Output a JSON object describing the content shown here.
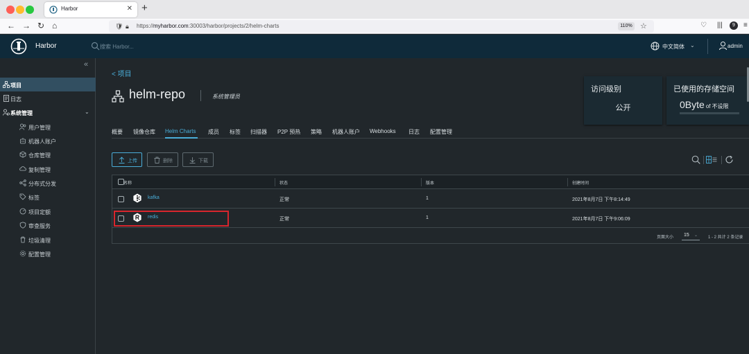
{
  "browser": {
    "tab_title": "Harbor",
    "url_prefix": "https://",
    "url_host": "myharbor.com",
    "url_path": ":30003/harbor/projects/2/helm-charts",
    "zoom": "110%",
    "extension_badge": "9"
  },
  "header": {
    "app_name": "Harbor",
    "search_placeholder": "搜索 Harbor...",
    "language": "中文简体",
    "user": "admin"
  },
  "sidebar": {
    "items": [
      {
        "label": "项目",
        "icon": "projects-icon"
      },
      {
        "label": "日志",
        "icon": "logs-icon"
      },
      {
        "label": "系统管理",
        "icon": "admin-icon"
      },
      {
        "label": "用户管理",
        "icon": "users-icon"
      },
      {
        "label": "机器人账户",
        "icon": "robot-icon"
      },
      {
        "label": "仓库管理",
        "icon": "registry-icon"
      },
      {
        "label": "复制管理",
        "icon": "replication-icon"
      },
      {
        "label": "分布式分发",
        "icon": "distribution-icon"
      },
      {
        "label": "标签",
        "icon": "tag-icon"
      },
      {
        "label": "项目定额",
        "icon": "quota-icon"
      },
      {
        "label": "审查服务",
        "icon": "shield-icon"
      },
      {
        "label": "垃圾清理",
        "icon": "trash-icon"
      },
      {
        "label": "配置管理",
        "icon": "gear-icon"
      }
    ]
  },
  "project": {
    "back_label": "< 项目",
    "name": "helm-repo",
    "role": "系统管理员"
  },
  "cards": {
    "access_title": "访问级别",
    "access_value": "公开",
    "storage_title": "已使用的存储空间",
    "storage_num": "0Byte",
    "storage_of": "of",
    "storage_quota": "不设限"
  },
  "tabs": [
    "概要",
    "镜像仓库",
    "Helm Charts",
    "成员",
    "标签",
    "扫描器",
    "P2P 预热",
    "策略",
    "机器人账户",
    "Webhooks",
    "日志",
    "配置管理"
  ],
  "toolbar": {
    "upload": "上传",
    "delete": "删除",
    "download": "下载"
  },
  "grid": {
    "columns": [
      "名称",
      "状态",
      "版本",
      "创建时间"
    ],
    "rows": [
      {
        "name": "kafka",
        "status": "正常",
        "version": "1",
        "created": "2021年8月7日 下午8:14:49"
      },
      {
        "name": "redis",
        "status": "正常",
        "version": "1",
        "created": "2021年8月7日 下午9:06:09"
      }
    ],
    "footer": {
      "page_size_label": "页面大小",
      "page_size": "15",
      "summary": "1 - 2 共计 2 条记录"
    }
  },
  "colors": {
    "header_bg": "#0f2a3a",
    "accent": "#4aaed9",
    "highlight": "#d8262d",
    "bg": "#21272b"
  }
}
